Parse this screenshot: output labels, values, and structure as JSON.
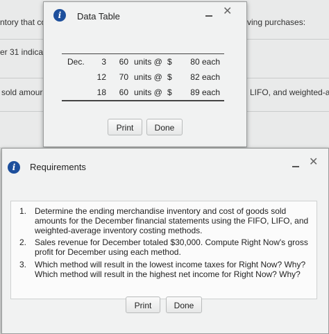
{
  "background": {
    "text_1": "ntory that co",
    "text_2": "ving purchases:",
    "text_3": "er 31 indica",
    "text_4": "sold amour",
    "text_5": "LIFO, and weighted-a"
  },
  "data_table_window": {
    "title": "Data Table",
    "icon": "info-icon",
    "rows": [
      {
        "month": "Dec.",
        "day": "3",
        "qty": "60",
        "units": "units @",
        "dollar": "$",
        "price": "80 each"
      },
      {
        "month": "",
        "day": "12",
        "qty": "70",
        "units": "units @",
        "dollar": "$",
        "price": "82 each"
      },
      {
        "month": "",
        "day": "18",
        "qty": "60",
        "units": "units @",
        "dollar": "$",
        "price": "89 each"
      }
    ],
    "print_label": "Print",
    "done_label": "Done"
  },
  "requirements_window": {
    "title": "Requirements",
    "icon": "info-icon",
    "items": [
      {
        "num": "1.",
        "text": "Determine the ending merchandise inventory and cost of goods sold amounts for the December financial statements using the FIFO, LIFO, and weighted-average inventory costing methods."
      },
      {
        "num": "2.",
        "text": "Sales revenue for December totaled $30,000. Compute Right Now's gross profit for December using each method."
      },
      {
        "num": "3.",
        "text": "Which method will result in the lowest income taxes for Right Now? Why? Which method will result in the highest net income for Right Now? Why?"
      }
    ],
    "print_label": "Print",
    "done_label": "Done"
  },
  "colors": {
    "info_icon": "#1d4f9c",
    "window_bg": "#f1f2f2"
  }
}
